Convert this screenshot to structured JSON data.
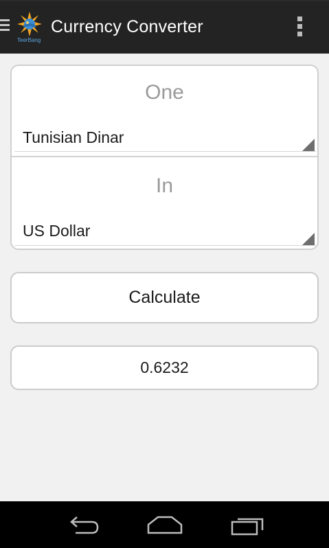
{
  "colors": {
    "action_bar": "#232323",
    "background": "#f1f1f1",
    "card": "#ffffff",
    "border": "#cfcfcf",
    "heading_text": "#9a9a9a",
    "nav_bar": "#000000"
  },
  "action_bar": {
    "title": "Currency Converter",
    "logo_text": "TeerBang",
    "icons": [
      "drawer-icon",
      "app-logo-icon",
      "overflow-menu-icon"
    ]
  },
  "converter": {
    "from_heading": "One",
    "from_currency": "Tunisian Dinar",
    "to_heading": "In",
    "to_currency": "US Dollar"
  },
  "calculate_label": "Calculate",
  "result": "0.6232",
  "nav_bar": {
    "icons": [
      "back-icon",
      "home-icon",
      "recents-icon"
    ]
  }
}
